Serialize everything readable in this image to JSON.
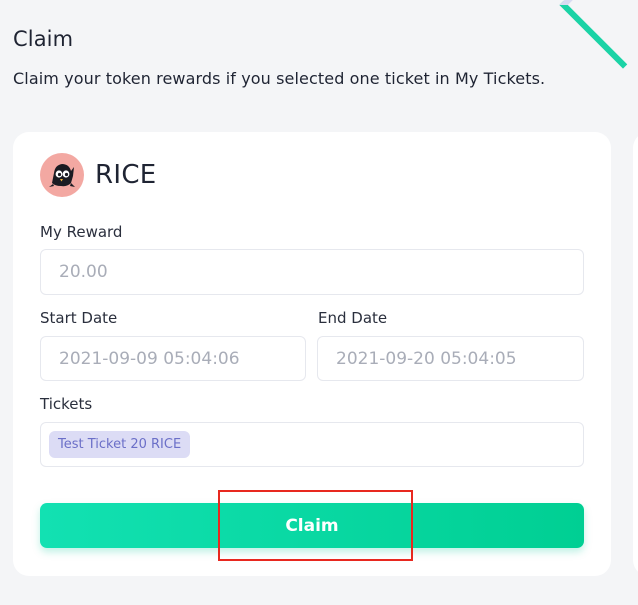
{
  "page": {
    "title": "Claim",
    "subtitle": "Claim your token rewards if you selected one ticket in My Tickets."
  },
  "card": {
    "token_name": "RICE",
    "token_icon": "penguin-avatar-icon",
    "reward": {
      "label": "My Reward",
      "value": "20.00"
    },
    "start_date": {
      "label": "Start Date",
      "value": "2021-09-09 05:04:06"
    },
    "end_date": {
      "label": "End Date",
      "value": "2021-09-20 05:04:05"
    },
    "tickets": {
      "label": "Tickets",
      "items": [
        "Test Ticket 20 RICE"
      ]
    },
    "claim_label": "Claim"
  },
  "colors": {
    "accent": "#00d39c",
    "highlight": "#e8281f",
    "ticket_tag_bg": "#dcdcf5",
    "ticket_tag_text": "#6b6fc8"
  }
}
